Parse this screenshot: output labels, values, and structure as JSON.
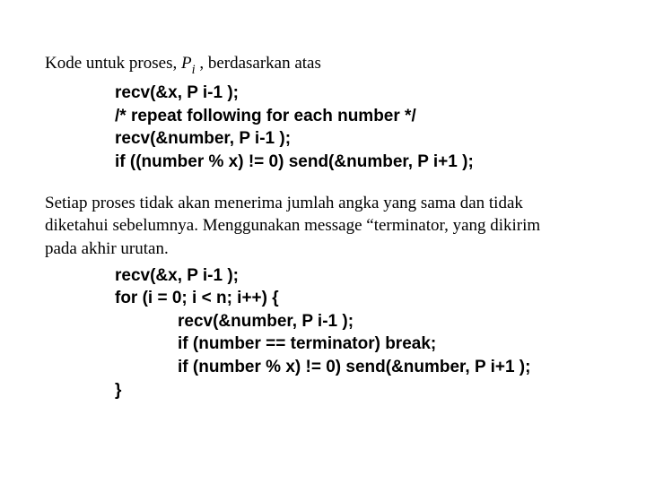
{
  "para1": {
    "pre": "Kode untuk proses, ",
    "sym_base": "P",
    "sym_sub": "i",
    "post": " , berdasarkan atas"
  },
  "code1": {
    "l1": "recv(&x, P i-1 );",
    "l2": "/* repeat following for each number */",
    "l3": "recv(&number, P i-1 );",
    "l4": "if ((number % x) != 0) send(&number, P i+1 );"
  },
  "para2": {
    "l1": "Setiap proses tidak akan menerima jumlah angka yang sama dan tidak",
    "l2": "diketahui sebelumnya. Menggunakan message “terminator, yang dikirim",
    "l3": "pada akhir urutan."
  },
  "code2": {
    "l1": "recv(&x, P i-1 );",
    "l2": "for (i = 0; i < n; i++) {",
    "l3": "recv(&number, P i-1 );",
    "l4": "if (number == terminator) break;",
    "l5": "if (number % x) != 0) send(&number, P i+1 );",
    "l6": "}"
  }
}
